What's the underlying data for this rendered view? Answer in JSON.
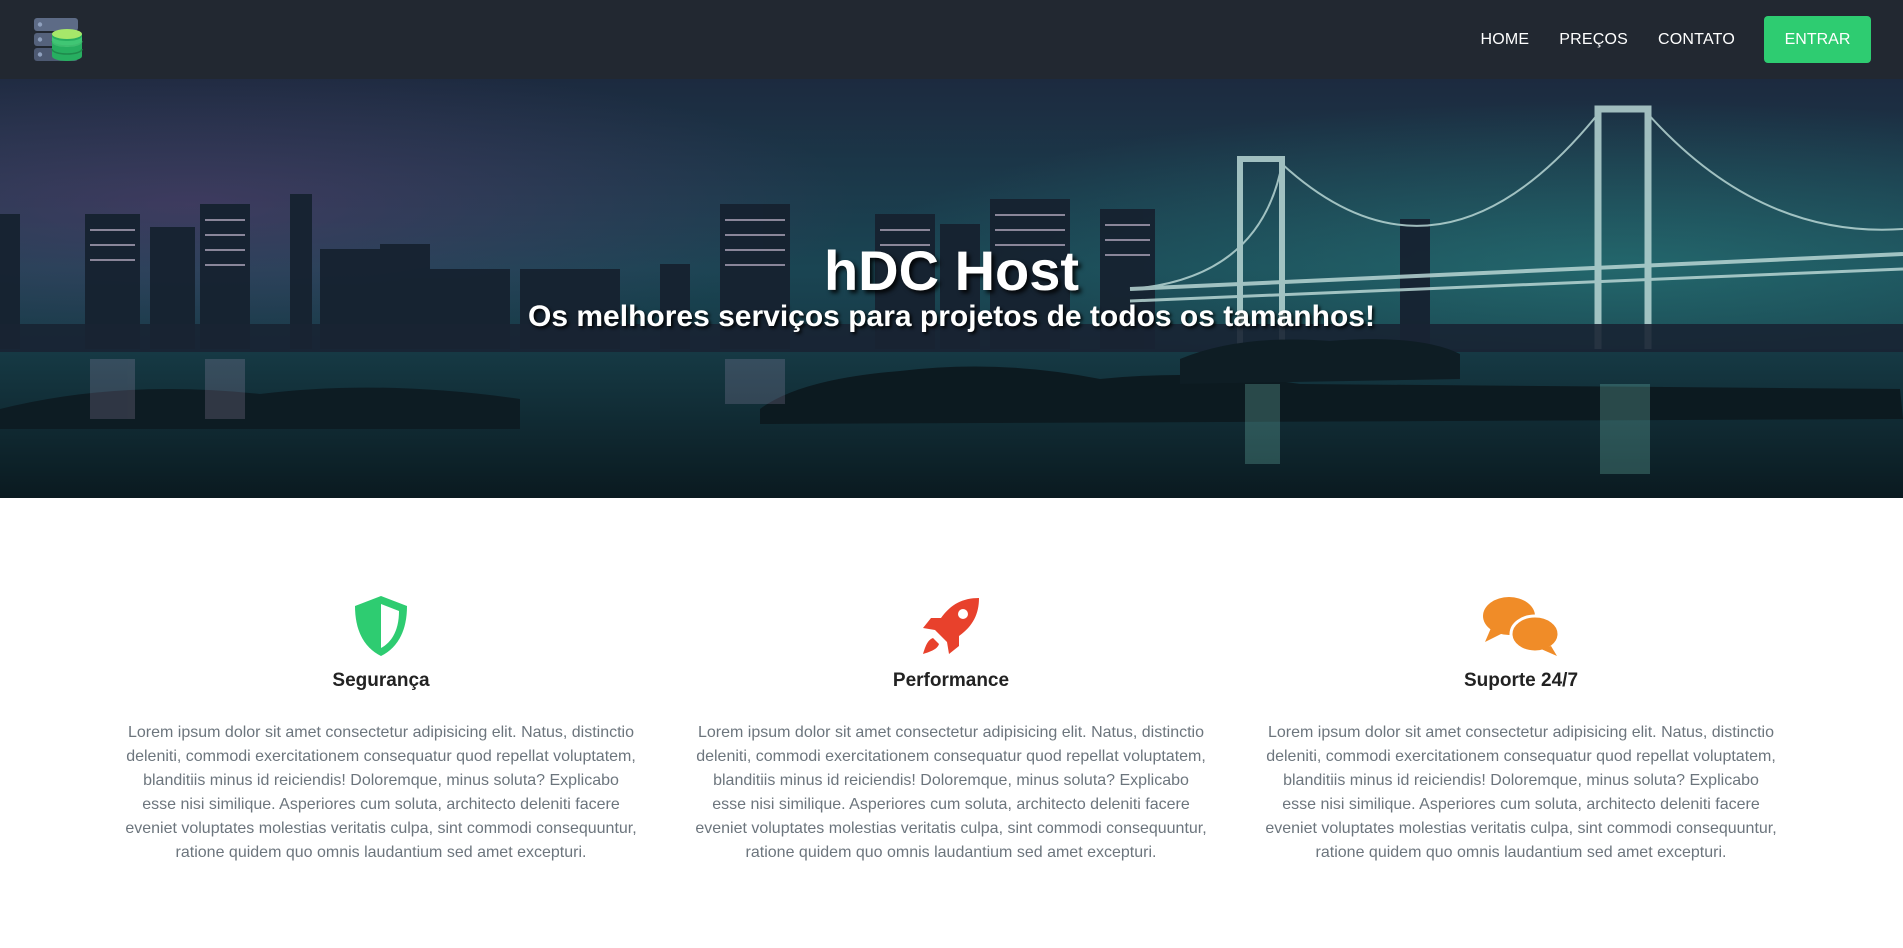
{
  "nav": {
    "logo_icon": "database-server-icon",
    "links": [
      "HOME",
      "PREÇOS",
      "CONTATO"
    ],
    "cta_label": "ENTRAR",
    "cta_color": "#2ecc71",
    "background": "#222831"
  },
  "hero": {
    "title": "hDC Host",
    "subtitle": "Os melhores serviços para projetos de todos os tamanhos!",
    "background_image": "night-city-bridge-skyline"
  },
  "features": [
    {
      "icon": "shield-icon",
      "icon_color": "#2ecc71",
      "title": "Segurança",
      "text": "Lorem ipsum dolor sit amet consectetur adipisicing elit. Natus, distinctio deleniti, commodi exercitationem consequatur quod repellat voluptatem, blanditiis minus id reiciendis! Doloremque, minus soluta? Explicabo esse nisi similique. Asperiores cum soluta, architecto deleniti facere eveniet voluptates molestias veritatis culpa, sint commodi consequuntur, ratione quidem quo omnis laudantium sed amet excepturi."
    },
    {
      "icon": "rocket-icon",
      "icon_color": "#e8412c",
      "title": "Performance",
      "text": "Lorem ipsum dolor sit amet consectetur adipisicing elit. Natus, distinctio deleniti, commodi exercitationem consequatur quod repellat voluptatem, blanditiis minus id reiciendis! Doloremque, minus soluta? Explicabo esse nisi similique. Asperiores cum soluta, architecto deleniti facere eveniet voluptates molestias veritatis culpa, sint commodi consequuntur, ratione quidem quo omnis laudantium sed amet excepturi."
    },
    {
      "icon": "chat-bubbles-icon",
      "icon_color": "#f08c28",
      "title": "Suporte 24/7",
      "text": "Lorem ipsum dolor sit amet consectetur adipisicing elit. Natus, distinctio deleniti, commodi exercitationem consequatur quod repellat voluptatem, blanditiis minus id reiciendis! Doloremque, minus soluta? Explicabo esse nisi similique. Asperiores cum soluta, architecto deleniti facere eveniet voluptates molestias veritatis culpa, sint commodi consequuntur, ratione quidem quo omnis laudantium sed amet excepturi."
    }
  ]
}
